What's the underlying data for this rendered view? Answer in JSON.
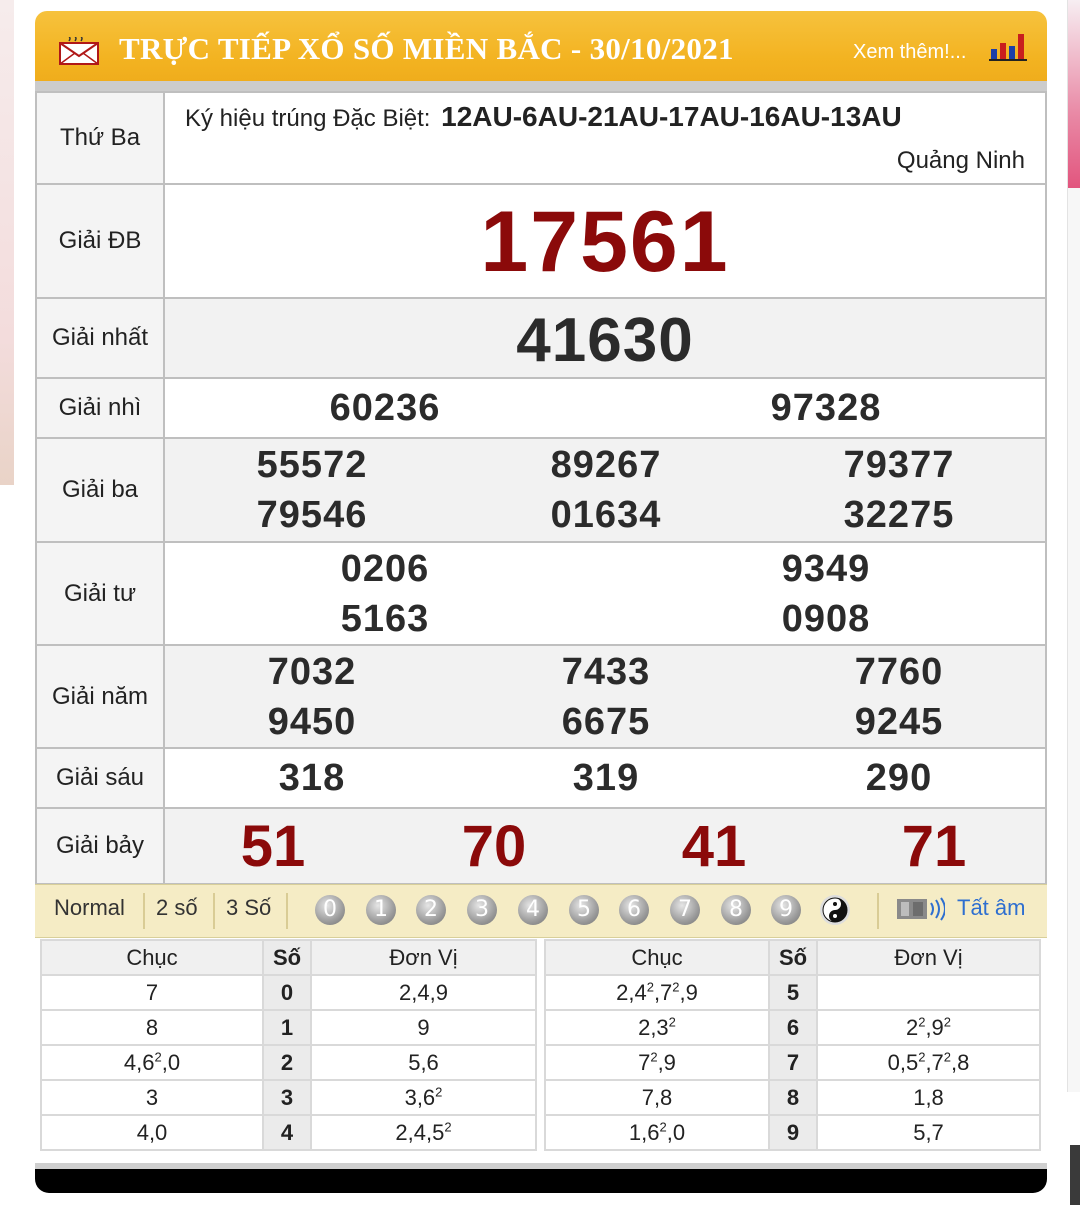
{
  "header": {
    "title": "TRỰC TIẾP XỔ SỐ MIỀN BẮC - 30/10/2021",
    "more_link": "Xem thêm!...",
    "mail_icon": "mail-icon",
    "chart_icon": "bar-chart-icon",
    "accent": "#f3b321"
  },
  "results": {
    "day": "Thứ Ba",
    "special_code_label": "Ký hiệu trúng Đặc Biệt:",
    "special_codes": "12AU-6AU-21AU-17AU-16AU-13AU",
    "province": "Quảng Ninh",
    "labels": {
      "db": "Giải ĐB",
      "g1": "Giải nhất",
      "g2": "Giải nhì",
      "g3": "Giải ba",
      "g4": "Giải tư",
      "g5": "Giải năm",
      "g6": "Giải sáu",
      "g7": "Giải bảy"
    },
    "db": "17561",
    "g1": "41630",
    "g2": [
      "60236",
      "97328"
    ],
    "g3": [
      "55572",
      "89267",
      "79377",
      "79546",
      "01634",
      "32275"
    ],
    "g4": [
      "0206",
      "9349",
      "5163",
      "0908"
    ],
    "g5": [
      "7032",
      "7433",
      "7760",
      "9450",
      "6675",
      "9245"
    ],
    "g6": [
      "318",
      "319",
      "290"
    ],
    "g7": [
      "51",
      "70",
      "41",
      "71"
    ],
    "highlight_color": "#8b0a0a"
  },
  "filter": {
    "normal": "Normal",
    "two": "2 số",
    "three": "3 Số",
    "digits": [
      "0",
      "1",
      "2",
      "3",
      "4",
      "5",
      "6",
      "7",
      "8",
      "9"
    ],
    "yinyang_icon": "yin-yang-icon",
    "tat_icon": "sound-icon",
    "tat_am": "Tất âm"
  },
  "loto": {
    "headers": {
      "chuc": "Chục",
      "so": "Số",
      "donvi": "Đơn Vị"
    },
    "left": [
      {
        "chuc": "7",
        "so": "0",
        "donvi": "2,4,9"
      },
      {
        "chuc": "8",
        "so": "1",
        "donvi": "9"
      },
      {
        "chuc": "4,6²,0",
        "so": "2",
        "donvi": "5,6"
      },
      {
        "chuc": "3",
        "so": "3",
        "donvi": "3,6²"
      },
      {
        "chuc": "4,0",
        "so": "4",
        "donvi": "2,4,5²"
      }
    ],
    "right": [
      {
        "chuc": "2,4²,7²,9",
        "so": "5",
        "donvi": ""
      },
      {
        "chuc": "2,3²",
        "so": "6",
        "donvi": "2²,9²"
      },
      {
        "chuc": "7²,9",
        "so": "7",
        "donvi": "0,5²,7²,8"
      },
      {
        "chuc": "7,8",
        "so": "8",
        "donvi": "1,8"
      },
      {
        "chuc": "1,6²,0",
        "so": "9",
        "donvi": "5,7"
      }
    ]
  }
}
